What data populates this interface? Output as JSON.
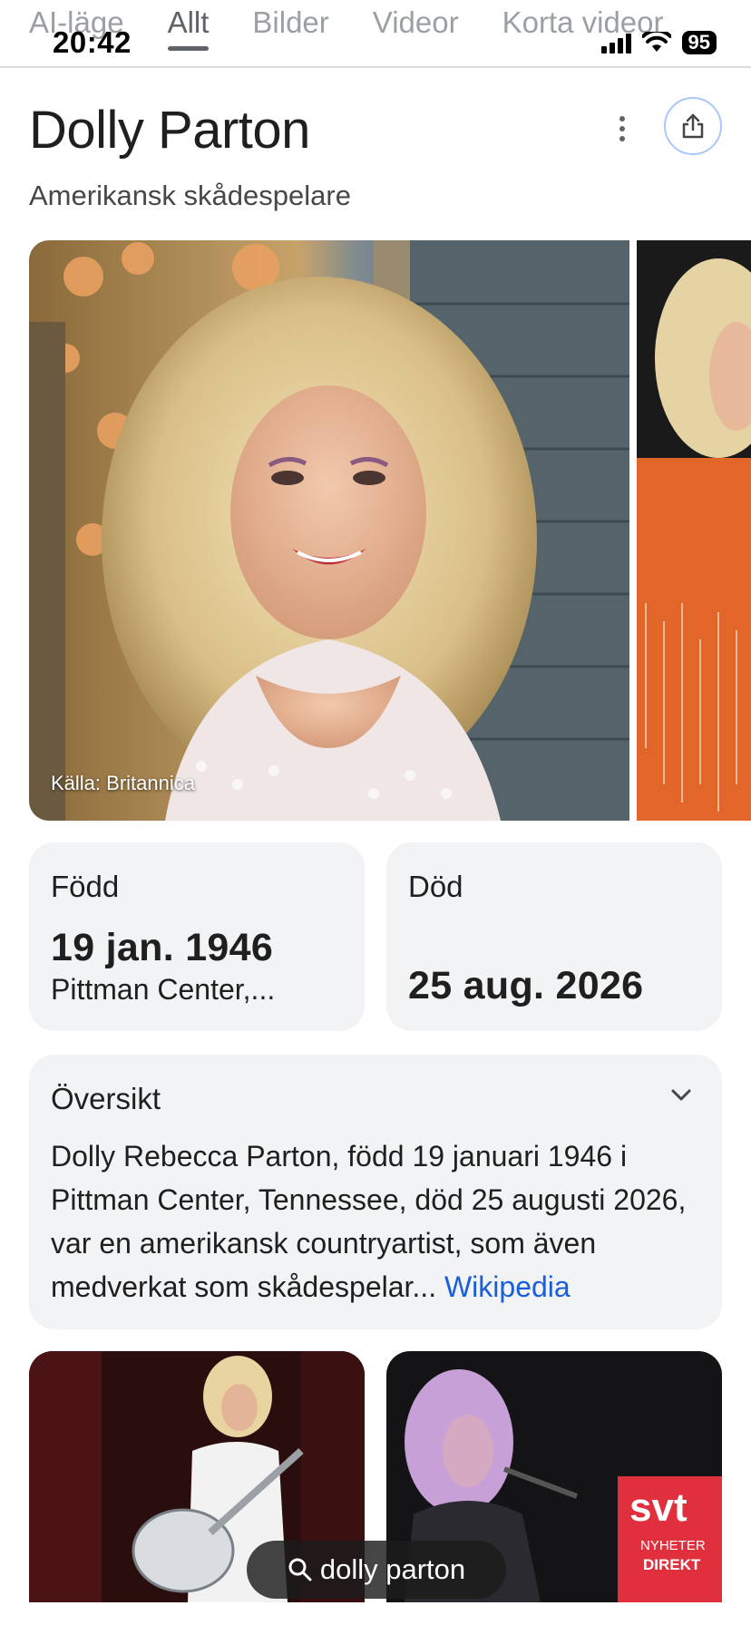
{
  "status_bar": {
    "time": "20:42",
    "battery": "95"
  },
  "tabs": [
    {
      "label": "AI-läge"
    },
    {
      "label": "Allt"
    },
    {
      "label": "Bilder"
    },
    {
      "label": "Videor"
    },
    {
      "label": "Korta videor"
    }
  ],
  "entity": {
    "title": "Dolly Parton",
    "subtitle": "Amerikansk skådespelare",
    "image_caption": "Källa: Britannica"
  },
  "born": {
    "label": "Född",
    "date": "19 jan. 1946",
    "place": "Pittman Center,..."
  },
  "died": {
    "label": "Död",
    "date": "25 aug. 2026"
  },
  "overview": {
    "title": "Översikt",
    "text": "Dolly Rebecca Parton, född 19 januari 1946 i Pittman Center, Tennessee, död 25 augusti 2026, var en amerikansk countryartist, som även medverkat som skådespelar...",
    "link": "Wikipedia"
  },
  "thumbnails": {
    "right_badge_top": "svt",
    "right_badge_line1": "NYHETER",
    "right_badge_line2": "DIREKT"
  },
  "search": {
    "query": "dolly parton"
  },
  "colors": {
    "accent_link": "#1a5ed9",
    "card_bg": "#f1f3f4",
    "svt_red": "#e0303d"
  }
}
